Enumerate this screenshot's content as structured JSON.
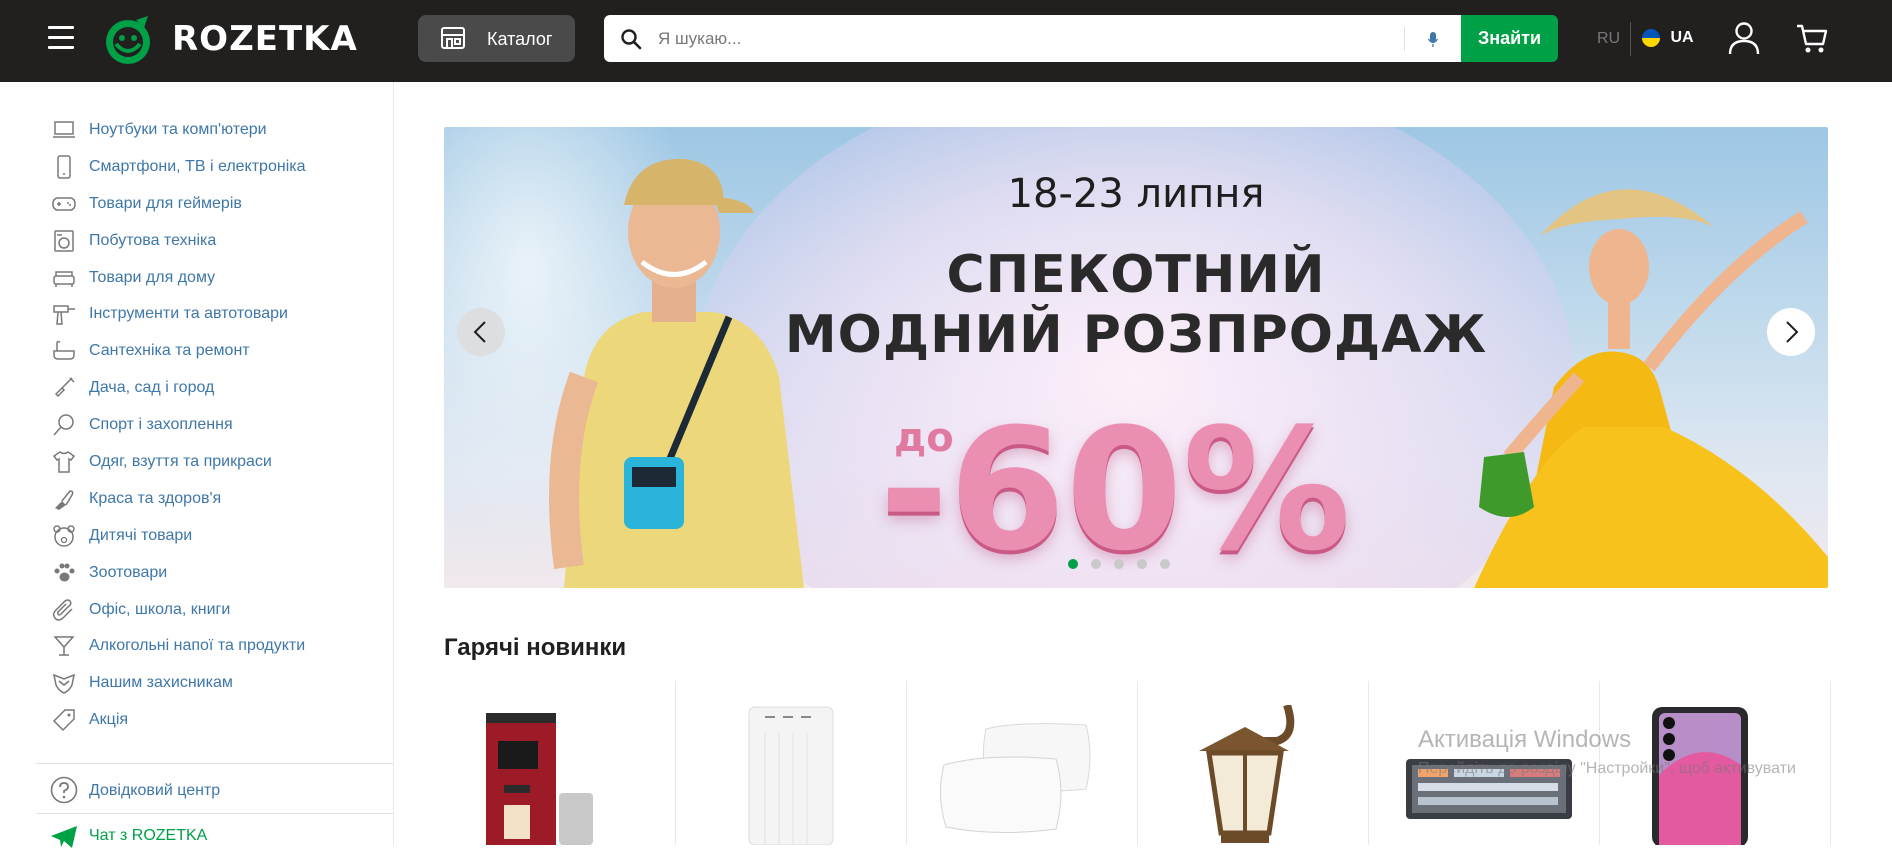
{
  "header": {
    "logo_text": "ROZETKA",
    "catalog_label": "Каталог",
    "search_placeholder": "Я шукаю...",
    "search_button_label": "Знайти",
    "lang_ru": "RU",
    "lang_ua": "UA",
    "background_color": "#221f1f",
    "accent_color": "#00a046"
  },
  "sidebar": {
    "items": [
      {
        "label": "Ноутбуки та комп'ютери",
        "icon": "laptop-icon"
      },
      {
        "label": "Смартфони, ТВ і електроніка",
        "icon": "smartphone-icon"
      },
      {
        "label": "Товари для геймерів",
        "icon": "gamepad-icon"
      },
      {
        "label": "Побутова техніка",
        "icon": "washing-machine-icon"
      },
      {
        "label": "Товари для дому",
        "icon": "sofa-icon"
      },
      {
        "label": "Інструменти та автотовари",
        "icon": "drill-icon"
      },
      {
        "label": "Сантехніка та ремонт",
        "icon": "bathtub-icon"
      },
      {
        "label": "Дача, сад і город",
        "icon": "shovel-icon"
      },
      {
        "label": "Спорт і захоплення",
        "icon": "racket-icon"
      },
      {
        "label": "Одяг, взуття та прикраси",
        "icon": "tshirt-icon"
      },
      {
        "label": "Краса та здоров'я",
        "icon": "lipstick-icon"
      },
      {
        "label": "Дитячі товари",
        "icon": "teddy-bear-icon"
      },
      {
        "label": "Зоотовари",
        "icon": "paw-icon"
      },
      {
        "label": "Офіс, школа, книги",
        "icon": "paperclip-icon"
      },
      {
        "label": "Алкогольні напої та продукти",
        "icon": "cocktail-icon"
      },
      {
        "label": "Нашим захисникам",
        "icon": "shield-icon"
      },
      {
        "label": "Акція",
        "icon": "tag-icon"
      }
    ],
    "help_label": "Довідковий центр",
    "chat_label": "Чат з ROZETKA"
  },
  "banner": {
    "date": "18-23 липня",
    "title_line1": "СПЕКОТНИЙ",
    "title_line2": "МОДНИЙ РОЗПРОДАЖ",
    "prefix": "до",
    "discount": "-60%",
    "slides_total": 5,
    "active_slide": 1
  },
  "hot_new": {
    "title": "Гарячі новинки",
    "products": [
      {
        "name": "coffee-machine",
        "icon": "coffee-machine-icon"
      },
      {
        "name": "power-bank",
        "icon": "power-bank-icon"
      },
      {
        "name": "pillows",
        "icon": "pillows-icon"
      },
      {
        "name": "wall-lantern",
        "icon": "lantern-icon"
      },
      {
        "name": "keyboard",
        "icon": "keyboard-icon"
      },
      {
        "name": "smartphone",
        "icon": "smartphone-icon"
      }
    ]
  },
  "watermark": {
    "line1": "Активація Windows",
    "line2": "Перейдіть до розділу \"Настройки\", щоб активувати"
  }
}
